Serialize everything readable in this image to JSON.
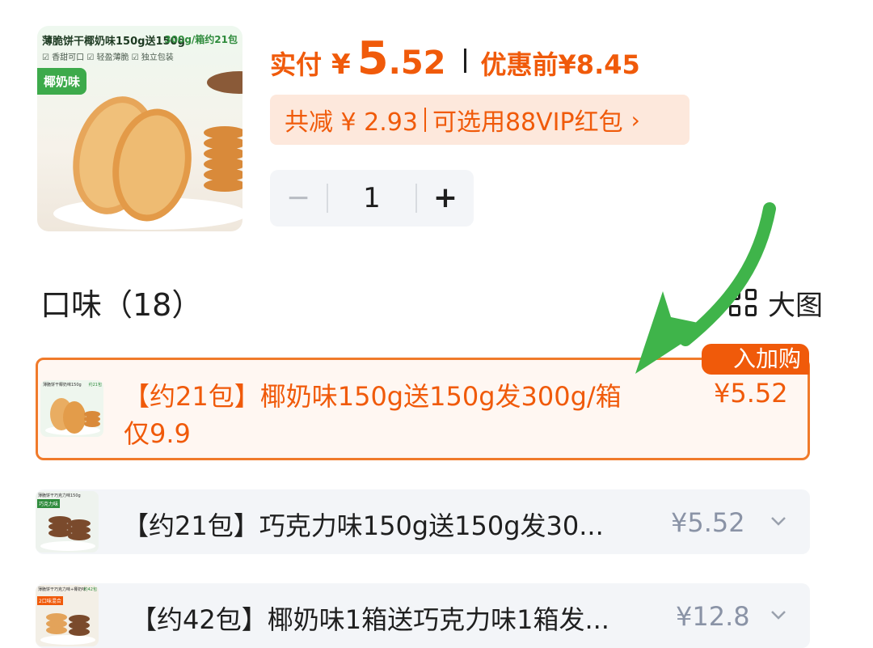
{
  "product": {
    "image_title": "薄脆饼干椰奶味150g送150g",
    "image_weight": "300g/箱约21包",
    "image_tags": "☑ 香甜可口  ☑ 轻盈薄脆  ☑ 独立包装",
    "image_badge": "椰奶味"
  },
  "price": {
    "label": "实付",
    "currency": "¥",
    "integer": "5",
    "decimal": ".52",
    "before_label": "优惠前",
    "before_value": "¥8.45",
    "accent_color": "#f05a0a"
  },
  "coupon": {
    "discount": "共减 ¥ 2.93",
    "offer": "可选用88VIP红包",
    "arrow": "›"
  },
  "stepper": {
    "minus": "−",
    "value": "1",
    "plus": "+"
  },
  "flavor": {
    "title": "口味（18）",
    "view_label": "大图",
    "view_icon": "grid-icon"
  },
  "options": [
    {
      "badge": "入加购",
      "line1": "【约21包】椰奶味150g送150g发300g/箱",
      "line2": "仅9.9",
      "price": "¥5.52",
      "thumb_title": "薄脆饼干椰奶味150g",
      "thumb_weight": "约21包"
    },
    {
      "label": "【约21包】巧克力味150g送150g发30...",
      "price": "¥5.52",
      "thumb_title": "薄脆饼干巧克力味150g",
      "thumb_badge": "巧克力味"
    },
    {
      "label": "【约42包】椰奶味1箱送巧克力味1箱发...",
      "price": "¥12.8",
      "thumb_title": "薄脆饼干巧克力味+椰奶味",
      "thumb_weight": "约42包",
      "thumb_badge": "2口味混合"
    }
  ],
  "annotation": {
    "arrow_color": "#3fb44a"
  }
}
